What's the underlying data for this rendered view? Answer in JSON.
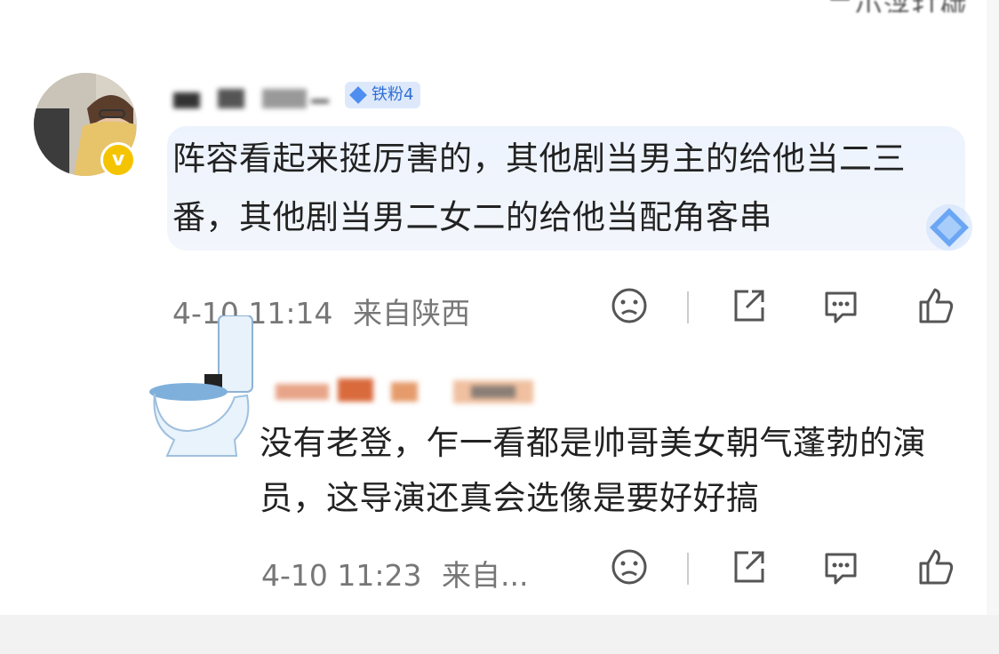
{
  "header": {
    "clipped_text": "二小浮打碰"
  },
  "comment": {
    "badge_label": "铁粉4",
    "text": "阵容看起来挺厉害的，其他剧当男主的给他当二三番，其他剧当男二女二的给他当配角客串",
    "timestamp": "4-10 11:14",
    "location": "来自陕西"
  },
  "reply": {
    "text": "没有老登，乍一看都是帅哥美女朝气蓬勃的演员，这导演还真会选像是要好好搞",
    "timestamp": "4-10 11:23",
    "location": "来自..."
  },
  "colors": {
    "badge_bg": "#dde9fb",
    "badge_text": "#2f6fd6",
    "bubble_bg": "#edf3fd",
    "verified": "#f5c400"
  },
  "icons": [
    "sad-face-icon",
    "share-icon",
    "comment-icon",
    "like-thumb-icon",
    "toilet-icon",
    "diamond-icon",
    "verified-icon"
  ]
}
